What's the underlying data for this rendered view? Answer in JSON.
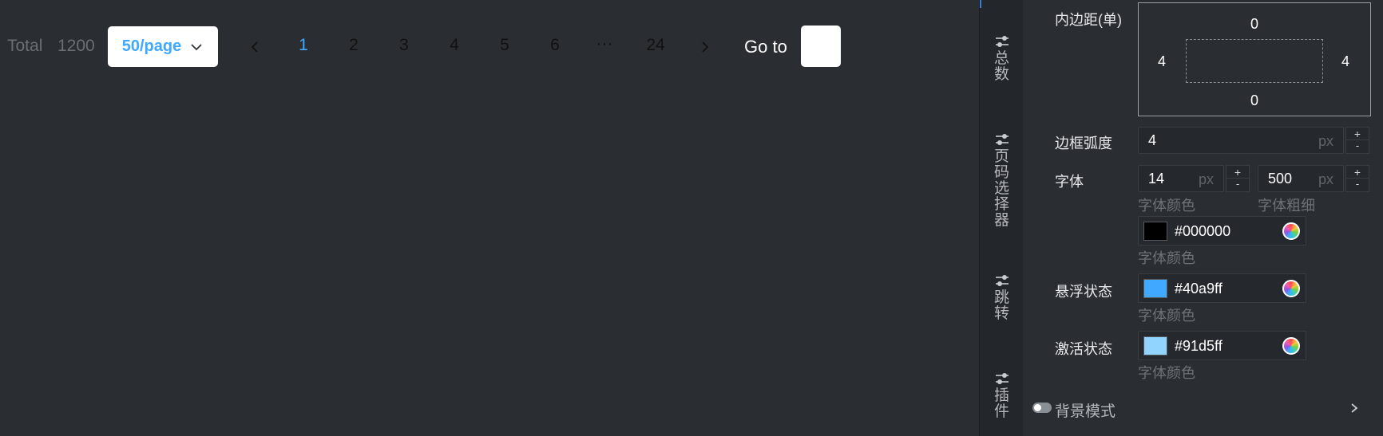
{
  "pagination": {
    "total_label": "Total",
    "total_value": "1200",
    "page_size": "50/page",
    "pages": [
      "1",
      "2",
      "3",
      "4",
      "5",
      "6",
      "···",
      "24"
    ],
    "active_page": "1",
    "goto_label": "Go to"
  },
  "tabs": [
    {
      "label": "总数",
      "chars": [
        "总",
        "数"
      ],
      "icon": "sliders-icon"
    },
    {
      "label": "页码选择器",
      "chars": [
        "页",
        "码",
        "选",
        "择",
        "器"
      ],
      "icon": "sliders-icon"
    },
    {
      "label": "跳转",
      "chars": [
        "跳",
        "转"
      ],
      "icon": "sliders-icon"
    },
    {
      "label": "插件",
      "chars": [
        "插",
        "件"
      ],
      "icon": "sliders-icon"
    }
  ],
  "panel": {
    "padding_label": "内边距(单)",
    "padding": {
      "top": "0",
      "left": "4",
      "right": "4",
      "bottom": "0"
    },
    "radius_label": "边框弧度",
    "radius_value": "4",
    "radius_unit": "px",
    "font_label": "字体",
    "font_size": "14",
    "font_size_unit": "px",
    "font_weight": "500",
    "font_weight_unit": "px",
    "font_color_sub": "字体颜色",
    "font_weight_sub": "字体粗细",
    "font_color": "#000000",
    "font_color_sub2": "字体颜色",
    "hover_label": "悬浮状态",
    "hover_color": "#40a9ff",
    "hover_sub": "字体颜色",
    "active_label": "激活状态",
    "active_color": "#91d5ff",
    "active_sub": "字体颜色",
    "bg_mode_label": "背景模式",
    "step_plus": "+",
    "step_minus": "-"
  },
  "colors": {
    "accent": "#40a9ff",
    "canvas_bg": "#2a2d32",
    "panel_bg": "#2a2d32"
  }
}
